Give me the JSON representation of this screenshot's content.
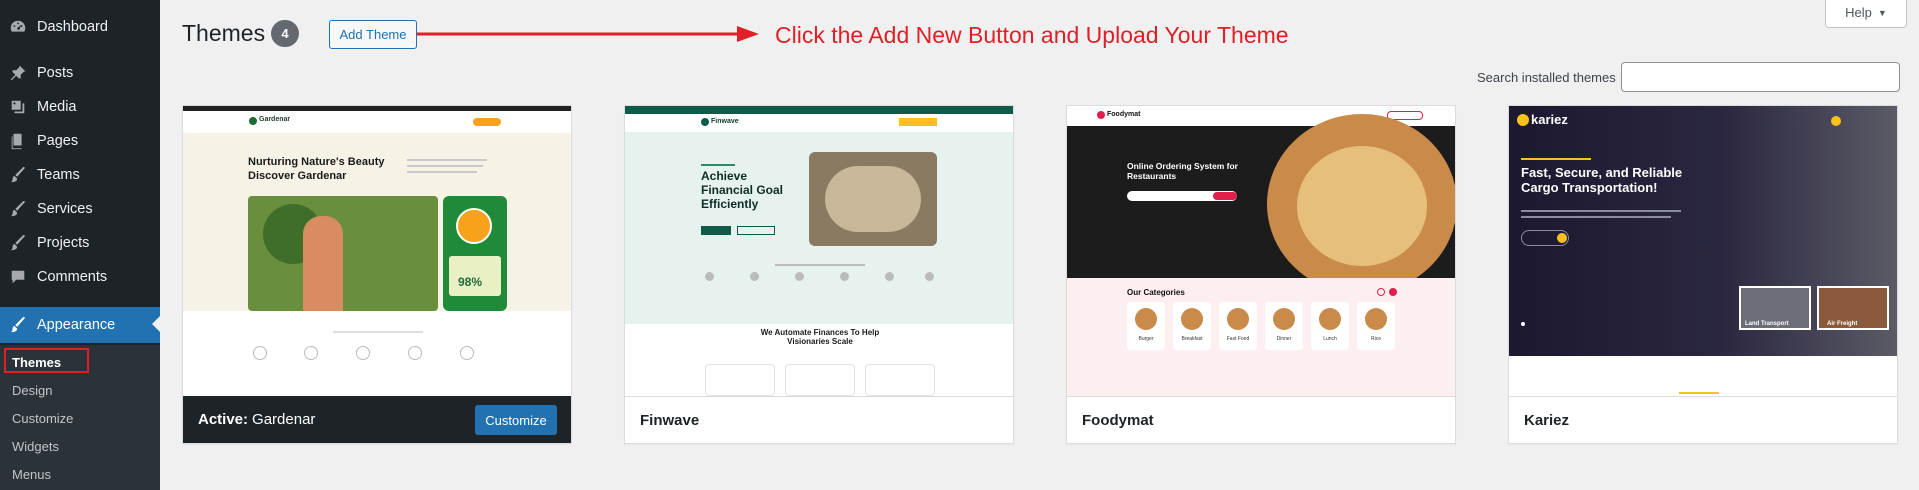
{
  "sidebar": {
    "items": [
      {
        "label": "Dashboard",
        "icon": "dashboard-icon"
      },
      {
        "label": "Posts",
        "icon": "pin-icon"
      },
      {
        "label": "Media",
        "icon": "media-icon"
      },
      {
        "label": "Pages",
        "icon": "pages-icon"
      },
      {
        "label": "Teams",
        "icon": "brush-icon"
      },
      {
        "label": "Services",
        "icon": "brush-icon"
      },
      {
        "label": "Projects",
        "icon": "brush-icon"
      },
      {
        "label": "Comments",
        "icon": "comment-icon"
      },
      {
        "label": "Appearance",
        "icon": "paintbrush-icon"
      }
    ],
    "submenu": [
      "Themes",
      "Design",
      "Customize",
      "Widgets",
      "Menus"
    ]
  },
  "header": {
    "title": "Themes",
    "count": "4",
    "add_button": "Add Theme",
    "annotation": "Click the Add New Button and Upload Your Theme",
    "help": "Help",
    "search_label": "Search installed themes",
    "search_placeholder": ""
  },
  "themes": [
    {
      "name": "Gardenar",
      "active_prefix": "Active:",
      "customize": "Customize",
      "preview": {
        "brand": "Gardenar",
        "headline1": "Nurturing Nature's Beauty",
        "headline2": "Discover Gardenar",
        "stat": "98%"
      }
    },
    {
      "name": "Finwave",
      "preview": {
        "brand": "Finwave",
        "headline": "Achieve Financial Goal Efficiently",
        "sub": "We Automate Finances To Help Visionaries Scale"
      }
    },
    {
      "name": "Foodymat",
      "preview": {
        "brand": "Foodymat",
        "headline": "Online Ordering System for Restaurants",
        "section": "Our Categories",
        "categories": [
          "Burger",
          "Breakfast",
          "Fast Food",
          "Dinner",
          "Lunch",
          "Rice"
        ]
      }
    },
    {
      "name": "Kariez",
      "preview": {
        "brand": "kariez",
        "headline": "Fast, Secure, and Reliable Cargo Transportation!",
        "tag1": "Land Transport",
        "tag2": "Air Freight"
      }
    }
  ],
  "colors": {
    "sidebar_bg": "#1d2327",
    "accent": "#2271b1",
    "annotation": "#e01f26"
  }
}
